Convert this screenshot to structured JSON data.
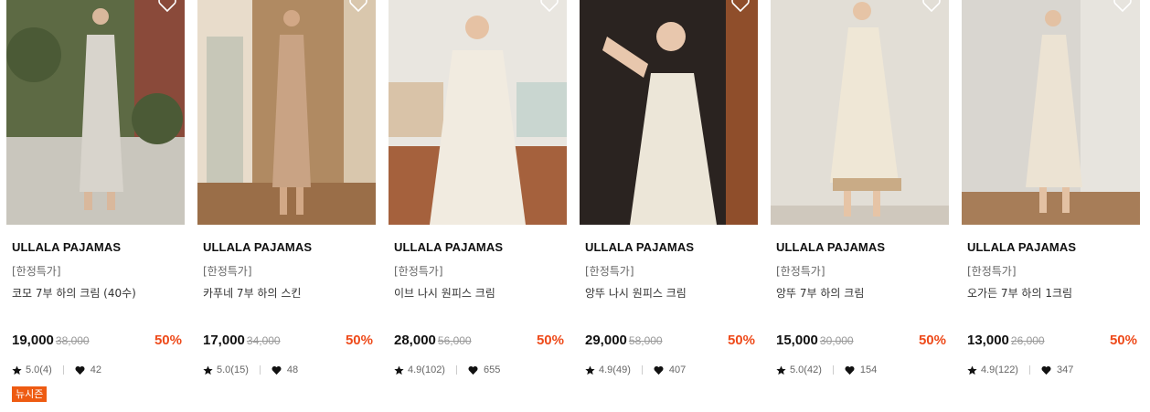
{
  "products": [
    {
      "brand": "ULLALA PAJAMAS",
      "tag": "[한정특가]",
      "name": "코모 7부 하의 크림 (40수)",
      "price": "19,000",
      "original_price": "38,000",
      "discount": "50%",
      "rating": "5.0(4)",
      "likes": "42",
      "badge": "뉴시즌",
      "image": {
        "bg": "#5d6a44",
        "dress": "#d8d4cc",
        "accent": "#8a4a3a"
      }
    },
    {
      "brand": "ULLALA PAJAMAS",
      "tag": "[한정특가]",
      "name": "카푸네 7부 하의 스킨",
      "price": "17,000",
      "original_price": "34,000",
      "discount": "50%",
      "rating": "5.0(15)",
      "likes": "48",
      "image": {
        "bg": "#b08a62",
        "dress": "#c9a384",
        "accent": "#e8dccb"
      }
    },
    {
      "brand": "ULLALA PAJAMAS",
      "tag": "[한정특가]",
      "name": "이브 나시 원피스 크림",
      "price": "28,000",
      "original_price": "56,000",
      "discount": "50%",
      "rating": "4.9(102)",
      "likes": "655",
      "image": {
        "bg": "#e9e6e0",
        "dress": "#f1ebe0",
        "accent": "#a5613d"
      }
    },
    {
      "brand": "ULLALA PAJAMAS",
      "tag": "[한정특가]",
      "name": "앙뚜 나시 원피스 크림",
      "price": "29,000",
      "original_price": "58,000",
      "discount": "50%",
      "rating": "4.9(49)",
      "likes": "407",
      "image": {
        "bg": "#2a2320",
        "dress": "#ece6d8",
        "accent": "#8f4e2b"
      }
    },
    {
      "brand": "ULLALA PAJAMAS",
      "tag": "[한정특가]",
      "name": "앙뚜 7부 하의 크림",
      "price": "15,000",
      "original_price": "30,000",
      "discount": "50%",
      "rating": "5.0(42)",
      "likes": "154",
      "image": {
        "bg": "#e2ded6",
        "dress": "#efe7d6",
        "accent": "#c9ab86"
      }
    },
    {
      "brand": "ULLALA PAJAMAS",
      "tag": "[한정특가]",
      "name": "오가든 7부 하의 1크림",
      "price": "13,000",
      "original_price": "26,000",
      "discount": "50%",
      "rating": "4.9(122)",
      "likes": "347",
      "image": {
        "bg": "#d9d6d0",
        "dress": "#ece3d3",
        "accent": "#a77d58"
      }
    }
  ],
  "colors": {
    "discount": "#ee4a1a",
    "badge": "#ee5b12"
  }
}
